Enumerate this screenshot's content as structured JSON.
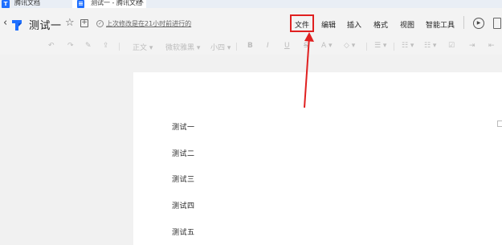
{
  "window_tabs": [
    {
      "icon": "tencent-docs-logo-icon",
      "title": "腾讯文档"
    },
    {
      "icon": "document-icon",
      "title": "测试一 - 腾讯文档",
      "close": "×"
    }
  ],
  "header": {
    "back": "‹",
    "logo": "tencent-docs-logo-icon",
    "title": "测试一",
    "save_status": "上次修改是在21小时前进行的"
  },
  "menu": {
    "file": "文件",
    "edit": "编辑",
    "insert": "插入",
    "format": "格式",
    "view": "视图",
    "tools": "智能工具"
  },
  "toolbar": {
    "style": "正文",
    "font": "微软雅黑",
    "size": "小四",
    "bold": "B",
    "italic": "I",
    "underline": "U",
    "strike": "S",
    "text_color": "A"
  },
  "document": {
    "lines": [
      "测试一",
      "测试二",
      "测试三",
      "测试四",
      "测试五"
    ]
  },
  "colors": {
    "brand": "#1e6fff",
    "highlight": "#e02020"
  }
}
